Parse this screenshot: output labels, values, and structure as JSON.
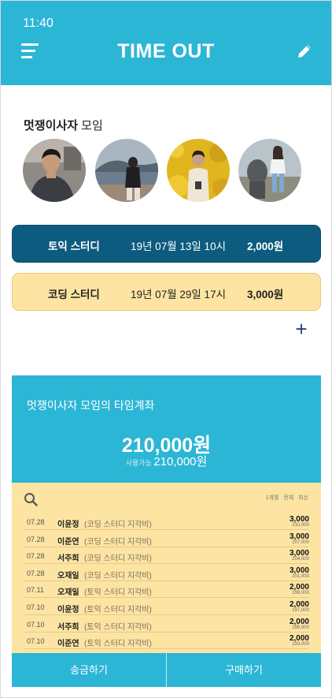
{
  "status_bar": {
    "time": "11:40"
  },
  "header": {
    "title": "TIME OUT",
    "menu_icon": "hamburger-menu-icon",
    "edit_icon": "pencil-icon"
  },
  "group": {
    "name": "멋쟁이사자",
    "suffix": " 모임",
    "members": [
      {
        "label": "member-1",
        "scene": "man-indoor"
      },
      {
        "label": "member-2",
        "scene": "woman-beach"
      },
      {
        "label": "member-3",
        "scene": "man-yellow-flowers"
      },
      {
        "label": "member-4",
        "scene": "woman-statue"
      }
    ]
  },
  "studies": [
    {
      "name": "토익 스터디",
      "date": "19년 07월 13일 10시",
      "amount": "2,000원"
    },
    {
      "name": "코딩 스터디",
      "date": "19년 07월 29일 17시",
      "amount": "3,000원"
    }
  ],
  "add_label": "+",
  "account": {
    "title": "멋쟁이사자 모임의 타임계좌",
    "balance": "210,000원",
    "available_label": "사용가능 ",
    "available_amount": "210,000원"
  },
  "transactions": {
    "filters": [
      "1개월",
      "전체",
      "최신"
    ],
    "rows": [
      {
        "date": "07.28",
        "name": "이윤정",
        "desc": "(코딩 스터디 지각비)",
        "amount": "3,000",
        "balance": "210,000"
      },
      {
        "date": "07.28",
        "name": "이준연",
        "desc": "(코딩 스터디 지각비)",
        "amount": "3,000",
        "balance": "207,000"
      },
      {
        "date": "07.28",
        "name": "서주희",
        "desc": "(코딩 스터디 지각비)",
        "amount": "3,000",
        "balance": "204,000"
      },
      {
        "date": "07.28",
        "name": "오재일",
        "desc": "(코딩 스터디 지각비)",
        "amount": "3,000",
        "balance": "201,000"
      },
      {
        "date": "07.11",
        "name": "오재일",
        "desc": "(토익 스터디 지각비)",
        "amount": "2,000",
        "balance": "199,000"
      },
      {
        "date": "07.10",
        "name": "이윤정",
        "desc": "(토익 스터디 지각비)",
        "amount": "2,000",
        "balance": "197,000"
      },
      {
        "date": "07.10",
        "name": "서주희",
        "desc": "(토익 스터디 지각비)",
        "amount": "2,000",
        "balance": "195,000"
      },
      {
        "date": "07.10",
        "name": "이준연",
        "desc": "(토익 스터디 지각비)",
        "amount": "2,000",
        "balance": "193,000"
      }
    ]
  },
  "buttons": {
    "send": "송금하기",
    "buy": "구매하기"
  },
  "colors": {
    "primary": "#2cb6d6",
    "dark_row": "#0d5b7e",
    "yellow": "#fde4a3",
    "accent": "#2f3c8f"
  }
}
